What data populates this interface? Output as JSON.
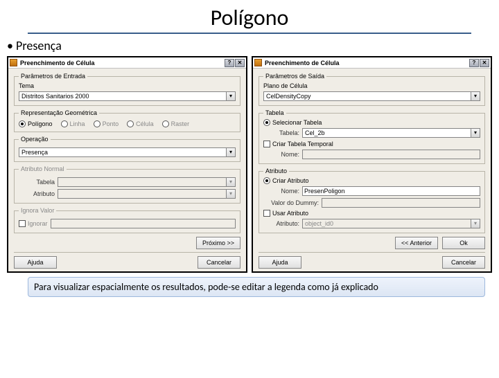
{
  "title": "Polígono",
  "bullet": "• Presença",
  "note": "Para visualizar espacialmente os resultados, pode-se editar a legenda como já explicado",
  "left": {
    "winTitle": "Preenchimento de Célula",
    "groupParams": "Parâmetros de Entrada",
    "themeLabel": "Tema",
    "themeValue": "Distritos Sanitarios 2000",
    "groupRepr": "Representação Geométrica",
    "reprOptions": [
      "Polígono",
      "Linha",
      "Ponto",
      "Célula",
      "Raster"
    ],
    "groupOp": "Operação",
    "opValue": "Presença",
    "groupAttr": "Atributo Normal",
    "tblLabel": "Tabela",
    "attrLabel": "Atributo",
    "groupIgnore": "Ignora Valor",
    "ignoreLabel": "Ignorar",
    "nextBtn": "Próximo >>",
    "helpBtn": "Ajuda",
    "cancelBtn": "Cancelar"
  },
  "right": {
    "winTitle": "Preenchimento de Célula",
    "groupOut": "Parâmetros de Saída",
    "planLabel": "Plano de Célula",
    "planValue": "CelDensityCopy",
    "groupTable": "Tabela",
    "selTableLabel": "Selecionar Tabela",
    "selTableValue": "Cel_2b",
    "tblRowLabel": "Tabela:",
    "newTempLabel": "Criar Tabela Temporal",
    "nameLabel": "Nome:",
    "groupAttr": "Atributo",
    "newAttrLabel": "Criar Atributo",
    "newAttrValue": "PresenPoligon",
    "dummyLabel": "Valor do Dummy:",
    "useAttrLabel": "Usar Atributo",
    "useAttrField": "Atributo:",
    "useAttrValue": "object_id0",
    "backBtn": "<< Anterior",
    "okBtn": "Ok",
    "helpBtn": "Ajuda",
    "cancelBtn": "Cancelar"
  }
}
